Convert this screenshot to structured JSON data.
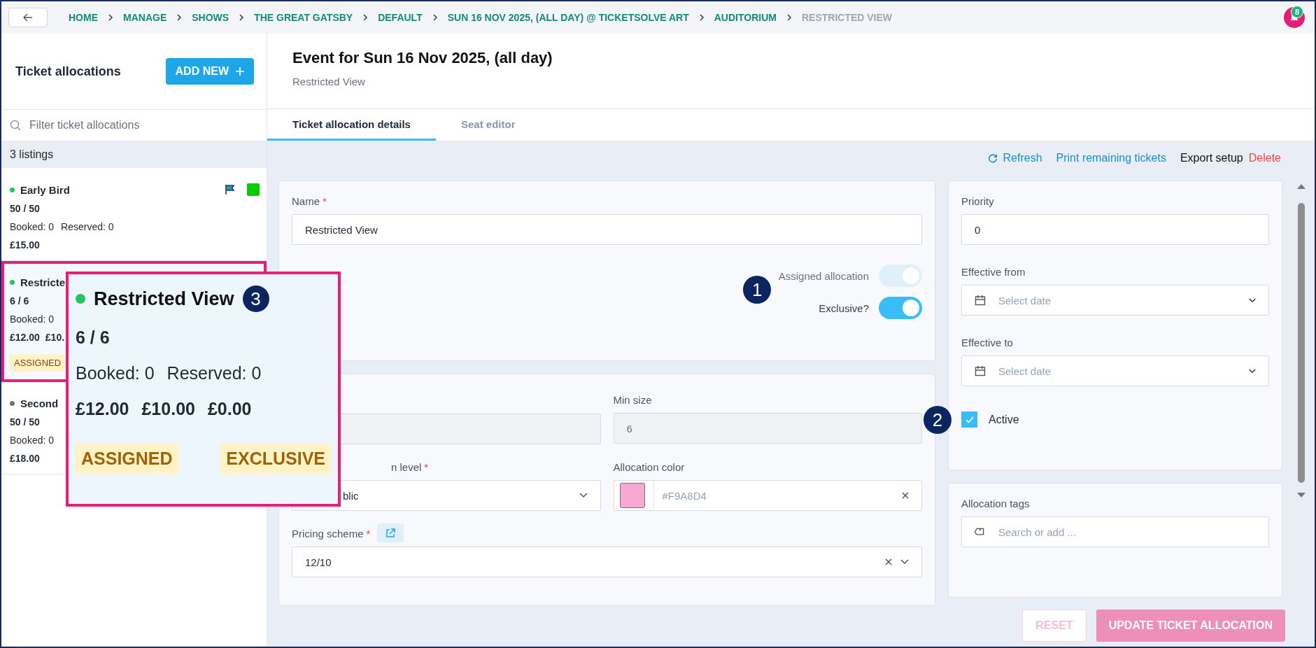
{
  "breadcrumb": [
    {
      "label": "HOME",
      "current": false
    },
    {
      "label": "MANAGE",
      "current": false
    },
    {
      "label": "SHOWS",
      "current": false
    },
    {
      "label": "THE GREAT GATSBY",
      "current": false
    },
    {
      "label": "DEFAULT",
      "current": false
    },
    {
      "label": "SUN 16 NOV 2025, (ALL DAY) @ TICKETSOLVE ART",
      "current": false
    },
    {
      "label": "AUDITORIUM",
      "current": false
    },
    {
      "label": "RESTRICTED VIEW",
      "current": true
    }
  ],
  "notification_count": "8",
  "sidebar": {
    "title": "Ticket allocations",
    "add_button": "ADD NEW",
    "filter_placeholder": "Filter ticket allocations",
    "count": "3 listings",
    "items": [
      {
        "name": "Early Bird",
        "active": true,
        "selected": false,
        "highlighted": false,
        "flagged": true,
        "color": "#00cc00",
        "capacity": "50 / 50",
        "booked": "Booked: 0",
        "reserved": "Reserved: 0",
        "prices": [
          "£15.00"
        ]
      },
      {
        "name": "Restricte",
        "active": true,
        "selected": true,
        "highlighted": true,
        "capacity": "6 / 6",
        "booked": "Booked: 0",
        "prices": [
          "£12.00",
          "£10."
        ],
        "tags": [
          "ASSIGNED"
        ]
      },
      {
        "name": "Second",
        "active": false,
        "selected": false,
        "highlighted": false,
        "capacity": "50 / 50",
        "booked": "Booked: 0",
        "prices": [
          "£18.00"
        ]
      }
    ]
  },
  "magnified_item": {
    "name": "Restricted View",
    "active": true,
    "capacity": "6 / 6",
    "booked": "Booked: 0",
    "reserved": "Reserved: 0",
    "prices": [
      "£12.00",
      "£10.00",
      "£0.00"
    ],
    "tags": [
      "ASSIGNED",
      "EXCLUSIVE"
    ]
  },
  "markers": [
    "1",
    "2",
    "3"
  ],
  "header": {
    "title": "Event for Sun 16 Nov 2025, (all day)",
    "subtitle": "Restricted View"
  },
  "tabs": [
    {
      "label": "Ticket allocation details",
      "selected": true
    },
    {
      "label": "Seat editor",
      "selected": false
    }
  ],
  "actions": [
    {
      "label": "Refresh",
      "kind": "refresh"
    },
    {
      "label": "Print remaining tickets",
      "kind": "link"
    },
    {
      "label": "Export setup",
      "kind": "plain"
    },
    {
      "label": "Delete",
      "kind": "danger"
    }
  ],
  "form": {
    "name": {
      "label": "Name",
      "required_mark": "*",
      "value": "Restricted View"
    },
    "toggles": [
      {
        "label": "Assigned allocation",
        "on": true,
        "disabled": true
      },
      {
        "label": "Exclusive?",
        "on": true,
        "disabled": false
      }
    ],
    "hidden_field": {
      "disabled": true
    },
    "min_size": {
      "label": "Min size",
      "value": "6",
      "disabled": true
    },
    "level": {
      "label": "n level",
      "required_mark": "*",
      "value": "blic"
    },
    "allocation_color": {
      "label": "Allocation color",
      "value": "#F9A8D4"
    },
    "pricing_scheme": {
      "label": "Pricing scheme",
      "required_mark": "*",
      "value": "12/10"
    },
    "priority": {
      "label": "Priority",
      "value": "0"
    },
    "effective_from": {
      "label": "Effective from",
      "placeholder": "Select date"
    },
    "effective_to": {
      "label": "Effective to",
      "placeholder": "Select date"
    },
    "active": {
      "label": "Active",
      "checked": true
    },
    "tags": {
      "label": "Allocation tags",
      "placeholder": "Search or add ..."
    }
  },
  "footer": [
    {
      "label": "RESET",
      "kind": "outline",
      "disabled": true
    },
    {
      "label": "UPDATE TICKET ALLOCATION",
      "kind": "primary",
      "disabled": true
    }
  ]
}
